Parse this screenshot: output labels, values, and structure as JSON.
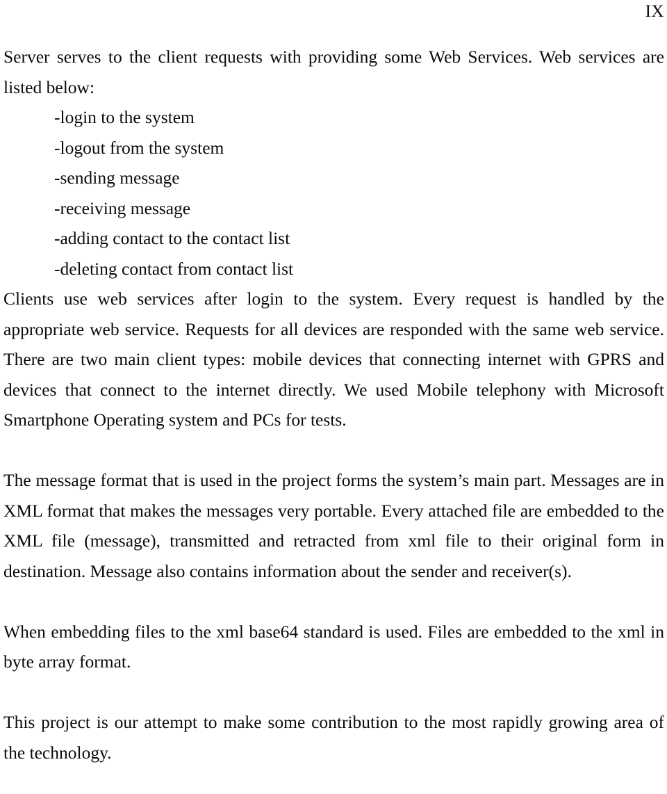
{
  "header": {
    "page_number": "IX"
  },
  "body": {
    "intro_paragraph": "Server serves to the client requests with providing some Web Services. Web services are listed below:",
    "service_list": [
      "-login to the system",
      "-logout from the system",
      "-sending message",
      "-receiving message",
      "-adding contact to the contact list",
      "-deleting contact from contact list"
    ],
    "paragraphs": [
      "Clients use web services after login to the system. Every request is handled by the appropriate web service. Requests for all devices are responded with the same web service. There are two main client types: mobile devices that connecting internet with GPRS and devices that connect to the internet directly. We used Mobile telephony with Microsoft Smartphone Operating system and PCs for tests.",
      "The message format that is used in the project forms the system’s main part. Messages are in XML format that makes the messages very portable. Every attached file are embedded to the XML file (message), transmitted and retracted from xml file to their original form in destination. Message also contains information about the sender and receiver(s).",
      "When embedding files to the xml base64 standard is used. Files are embedded to the xml in byte array format.",
      "This project is our attempt to make some contribution to the most rapidly growing area of the technology."
    ]
  },
  "colors": {
    "page_background": "#ffffff",
    "text": "#0b0b0b"
  }
}
